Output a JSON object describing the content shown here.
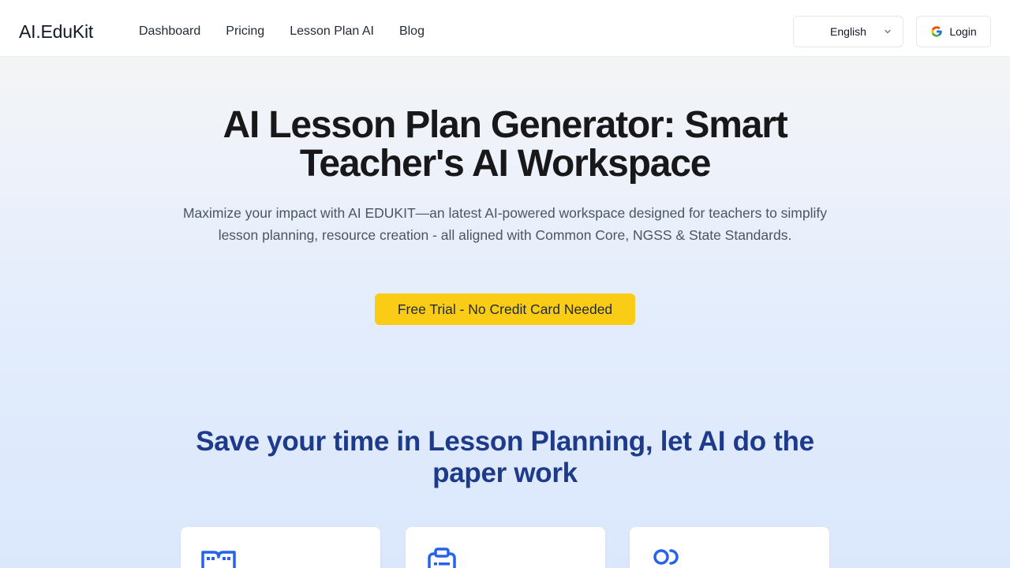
{
  "nav": {
    "brand": "AI.EduKit",
    "links": [
      "Dashboard",
      "Pricing",
      "Lesson Plan AI",
      "Blog"
    ],
    "language": "English",
    "login_label": "Login"
  },
  "hero": {
    "title": "AI Lesson Plan Generator: Smart Teacher's AI Workspace",
    "subtitle": "Maximize your impact with AI EDUKIT—an latest AI-powered workspace designed for teachers to simplify lesson planning, resource creation - all aligned with Common Core, NGSS & State Standards.",
    "cta": "Free Trial - No Credit Card Needed"
  },
  "section": {
    "title": "Save your time in Lesson Planning, let AI do the paper work"
  },
  "cards": [
    {
      "icon": "book-open-icon"
    },
    {
      "icon": "clipboard-icon"
    },
    {
      "icon": "toggle-icon"
    }
  ],
  "colors": {
    "accent": "#facc15",
    "section_title": "#1e3a8a",
    "icon": "#2563eb"
  }
}
